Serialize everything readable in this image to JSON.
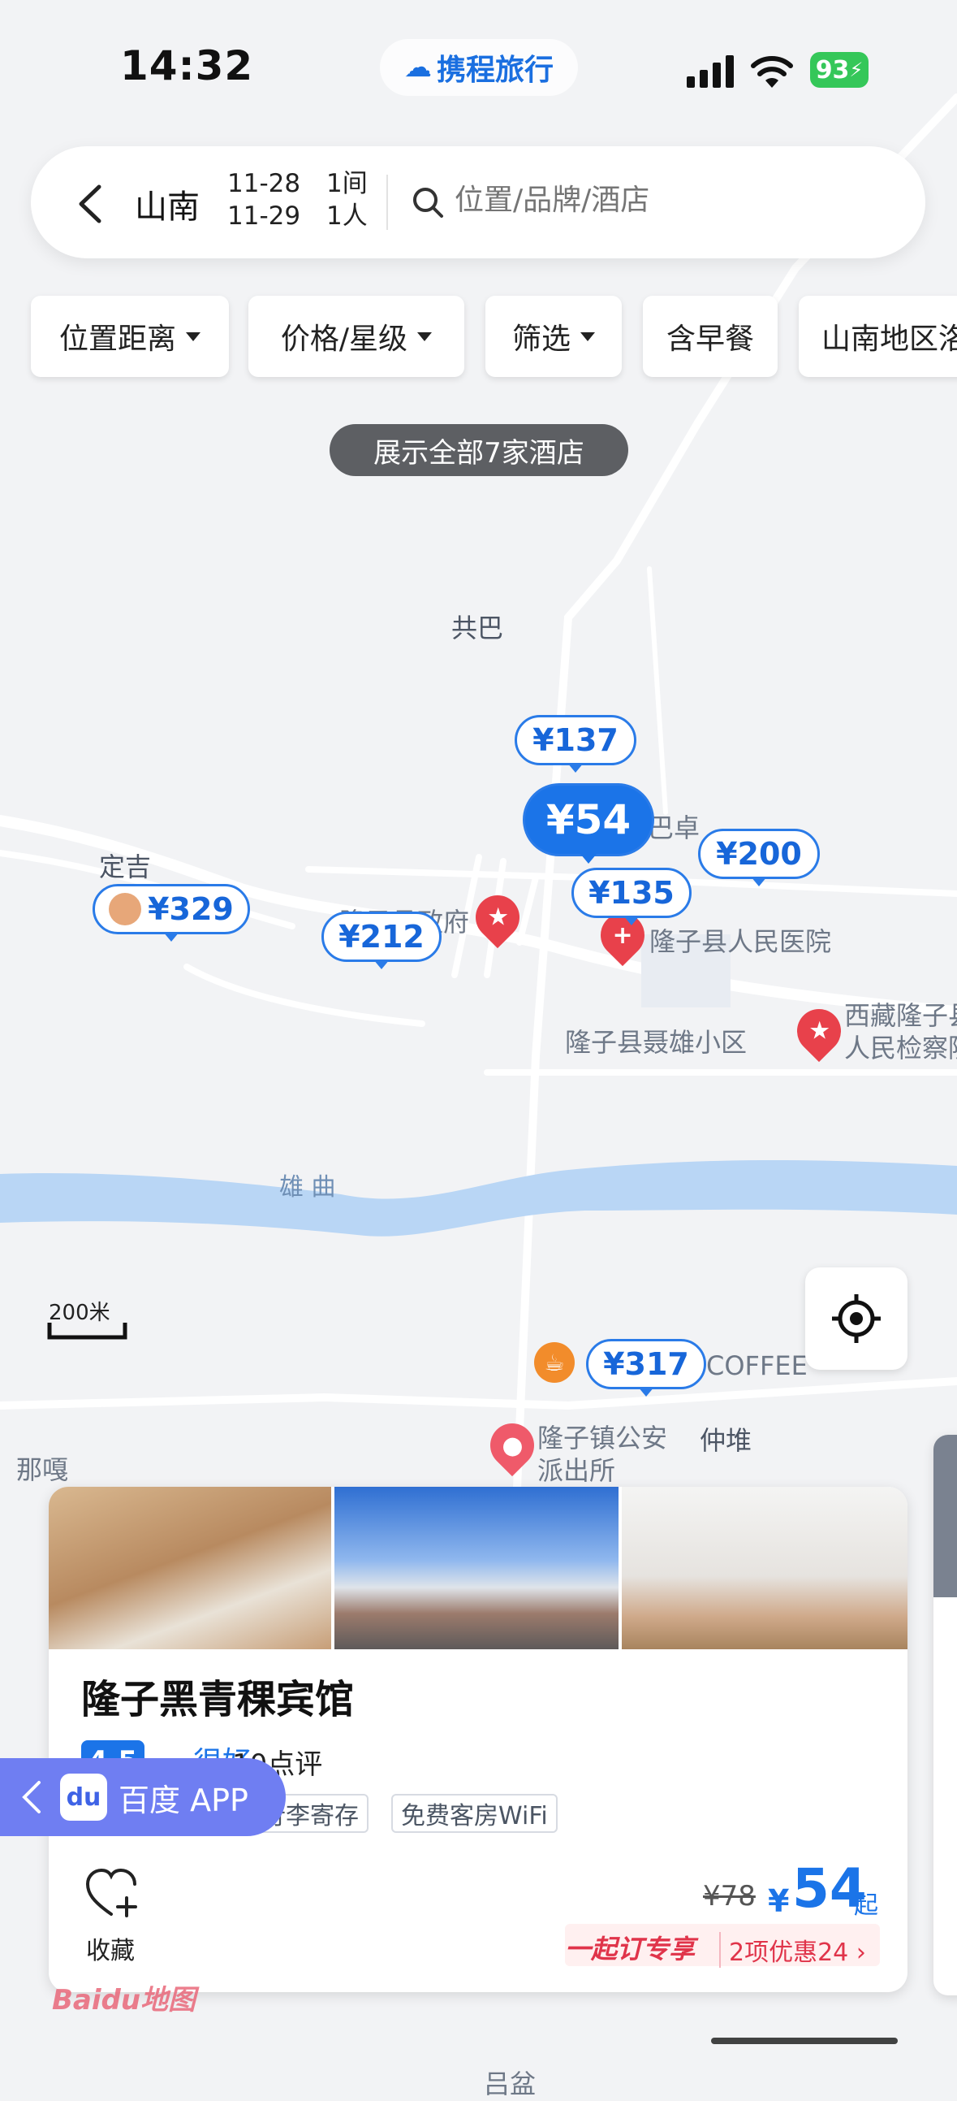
{
  "status_bar": {
    "time": "14:32",
    "brand": "携程旅行",
    "battery": "93"
  },
  "search": {
    "city": "山南",
    "checkin": "11-28",
    "checkout": "11-29",
    "rooms": "1间",
    "guests": "1人",
    "placeholder": "位置/品牌/酒店"
  },
  "filters": [
    "位置距离",
    "价格/星级",
    "筛选",
    "含早餐",
    "山南地区洛"
  ],
  "show_all": "展示全部7家酒店",
  "map": {
    "labels": {
      "gongba": "共巴",
      "dingji": "定吉",
      "jiabazhuo": "嘉巴卓",
      "gov": "隆子县政府",
      "hospital": "隆子县人民医院",
      "community": "隆子县聂雄小区",
      "procuratorate_1": "西藏隆子县",
      "procuratorate_2": "人民检察院",
      "river": "雄 曲",
      "coffee": "COFFEE",
      "town_1": "隆子镇公安",
      "town_2": "派出所",
      "zhongdui": "仲堆",
      "naga": "那嘎",
      "bottom": "吕盆",
      "scale": "200米"
    },
    "price_markers": [
      "¥137",
      "¥54",
      "¥200",
      "¥135",
      "¥329",
      "¥212",
      "¥317"
    ]
  },
  "hotel_card": {
    "name": "隆子黑青稞宾馆",
    "score": "4.5",
    "score_label": "很好",
    "reviews": "10点评",
    "tags": [
      "行李寄存",
      "免费客房WiFi"
    ],
    "favorite_label": "收藏",
    "original_price": "¥78",
    "currency": "¥",
    "price": "54",
    "price_suffix": "起",
    "promo_title": "一起订专享",
    "promo_detail": "2项优惠24"
  },
  "baidu_app": {
    "label": "百度 APP",
    "watermark": "Baidu地图"
  },
  "colors": {
    "accent": "#1b74e8",
    "river": "#b9d6f5",
    "promo": "#e0344a"
  }
}
